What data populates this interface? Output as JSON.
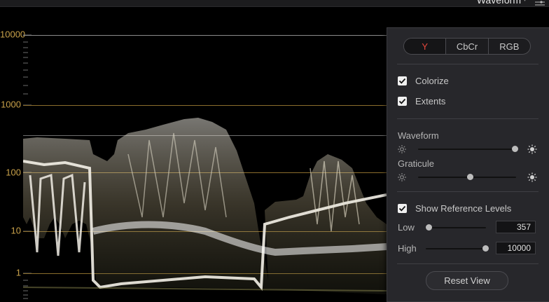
{
  "topbar": {
    "scope_title": "Waveform",
    "dropdown_caret": "▾",
    "menu_icon": "options-icon"
  },
  "scope": {
    "y_axis_labels": [
      "10000",
      "1000",
      "100",
      "10",
      "1"
    ],
    "graticule_color": "#c9a24a"
  },
  "panel": {
    "modes": [
      {
        "label": "Y",
        "active": true
      },
      {
        "label": "CbCr",
        "active": false
      },
      {
        "label": "RGB",
        "active": false
      }
    ],
    "colorize": {
      "label": "Colorize",
      "checked": true
    },
    "extents": {
      "label": "Extents",
      "checked": true
    },
    "waveform_label": "Waveform",
    "waveform_level": 0.95,
    "graticule_label": "Graticule",
    "graticule_level": 0.5,
    "show_reference": {
      "label": "Show Reference Levels",
      "checked": true
    },
    "low": {
      "label": "Low",
      "value": "357",
      "level": 0.0
    },
    "high": {
      "label": "High",
      "value": "10000",
      "level": 1.0
    },
    "reset_label": "Reset View"
  }
}
